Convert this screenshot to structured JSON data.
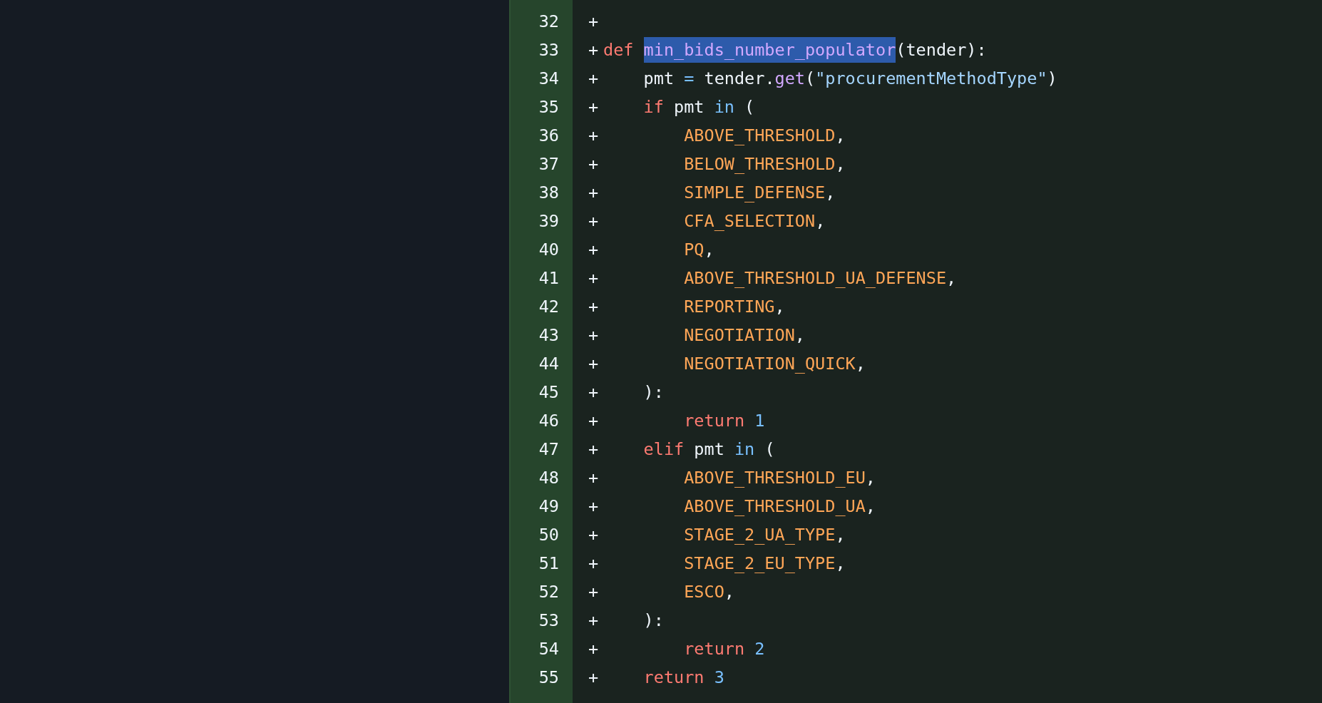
{
  "diff": {
    "lines": [
      {
        "number": "32",
        "sign": "+"
      },
      {
        "number": "33",
        "sign": "+",
        "tokens": [
          {
            "kind": "keyword",
            "text": "def "
          },
          {
            "kind": "function",
            "text": "min_bids_number_populator",
            "selected": true
          },
          {
            "kind": "plain",
            "text": "(tender):"
          }
        ]
      },
      {
        "number": "34",
        "sign": "+",
        "tokens": [
          {
            "kind": "plain",
            "text": "    pmt "
          },
          {
            "kind": "operator",
            "text": "="
          },
          {
            "kind": "plain",
            "text": " tender."
          },
          {
            "kind": "function",
            "text": "get"
          },
          {
            "kind": "plain",
            "text": "("
          },
          {
            "kind": "string",
            "text": "\"procurementMethodType\""
          },
          {
            "kind": "plain",
            "text": ")"
          }
        ]
      },
      {
        "number": "35",
        "sign": "+",
        "tokens": [
          {
            "kind": "keyword",
            "text": "    if"
          },
          {
            "kind": "plain",
            "text": " pmt "
          },
          {
            "kind": "operator",
            "text": "in"
          },
          {
            "kind": "plain",
            "text": " ("
          }
        ]
      },
      {
        "number": "36",
        "sign": "+",
        "tokens": [
          {
            "kind": "constant",
            "text": "        ABOVE_THRESHOLD"
          },
          {
            "kind": "plain",
            "text": ","
          }
        ]
      },
      {
        "number": "37",
        "sign": "+",
        "tokens": [
          {
            "kind": "constant",
            "text": "        BELOW_THRESHOLD"
          },
          {
            "kind": "plain",
            "text": ","
          }
        ]
      },
      {
        "number": "38",
        "sign": "+",
        "tokens": [
          {
            "kind": "constant",
            "text": "        SIMPLE_DEFENSE"
          },
          {
            "kind": "plain",
            "text": ","
          }
        ]
      },
      {
        "number": "39",
        "sign": "+",
        "tokens": [
          {
            "kind": "constant",
            "text": "        CFA_SELECTION"
          },
          {
            "kind": "plain",
            "text": ","
          }
        ]
      },
      {
        "number": "40",
        "sign": "+",
        "tokens": [
          {
            "kind": "constant",
            "text": "        PQ"
          },
          {
            "kind": "plain",
            "text": ","
          }
        ]
      },
      {
        "number": "41",
        "sign": "+",
        "tokens": [
          {
            "kind": "constant",
            "text": "        ABOVE_THRESHOLD_UA_DEFENSE"
          },
          {
            "kind": "plain",
            "text": ","
          }
        ]
      },
      {
        "number": "42",
        "sign": "+",
        "tokens": [
          {
            "kind": "constant",
            "text": "        REPORTING"
          },
          {
            "kind": "plain",
            "text": ","
          }
        ]
      },
      {
        "number": "43",
        "sign": "+",
        "tokens": [
          {
            "kind": "constant",
            "text": "        NEGOTIATION"
          },
          {
            "kind": "plain",
            "text": ","
          }
        ]
      },
      {
        "number": "44",
        "sign": "+",
        "tokens": [
          {
            "kind": "constant",
            "text": "        NEGOTIATION_QUICK"
          },
          {
            "kind": "plain",
            "text": ","
          }
        ]
      },
      {
        "number": "45",
        "sign": "+",
        "tokens": [
          {
            "kind": "plain",
            "text": "    ):"
          }
        ]
      },
      {
        "number": "46",
        "sign": "+",
        "tokens": [
          {
            "kind": "keyword",
            "text": "        return"
          },
          {
            "kind": "number",
            "text": " 1"
          }
        ]
      },
      {
        "number": "47",
        "sign": "+",
        "tokens": [
          {
            "kind": "keyword",
            "text": "    elif"
          },
          {
            "kind": "plain",
            "text": " pmt "
          },
          {
            "kind": "operator",
            "text": "in"
          },
          {
            "kind": "plain",
            "text": " ("
          }
        ]
      },
      {
        "number": "48",
        "sign": "+",
        "tokens": [
          {
            "kind": "constant",
            "text": "        ABOVE_THRESHOLD_EU"
          },
          {
            "kind": "plain",
            "text": ","
          }
        ]
      },
      {
        "number": "49",
        "sign": "+",
        "tokens": [
          {
            "kind": "constant",
            "text": "        ABOVE_THRESHOLD_UA"
          },
          {
            "kind": "plain",
            "text": ","
          }
        ]
      },
      {
        "number": "50",
        "sign": "+",
        "tokens": [
          {
            "kind": "constant",
            "text": "        STAGE_2_UA_TYPE"
          },
          {
            "kind": "plain",
            "text": ","
          }
        ]
      },
      {
        "number": "51",
        "sign": "+",
        "tokens": [
          {
            "kind": "constant",
            "text": "        STAGE_2_EU_TYPE"
          },
          {
            "kind": "plain",
            "text": ","
          }
        ]
      },
      {
        "number": "52",
        "sign": "+",
        "tokens": [
          {
            "kind": "constant",
            "text": "        ESCO"
          },
          {
            "kind": "plain",
            "text": ","
          }
        ]
      },
      {
        "number": "53",
        "sign": "+",
        "tokens": [
          {
            "kind": "plain",
            "text": "    ):"
          }
        ]
      },
      {
        "number": "54",
        "sign": "+",
        "tokens": [
          {
            "kind": "keyword",
            "text": "        return"
          },
          {
            "kind": "number",
            "text": " 2"
          }
        ]
      },
      {
        "number": "55",
        "sign": "+",
        "tokens": [
          {
            "kind": "keyword",
            "text": "    return"
          },
          {
            "kind": "number",
            "text": " 3"
          }
        ]
      }
    ]
  }
}
